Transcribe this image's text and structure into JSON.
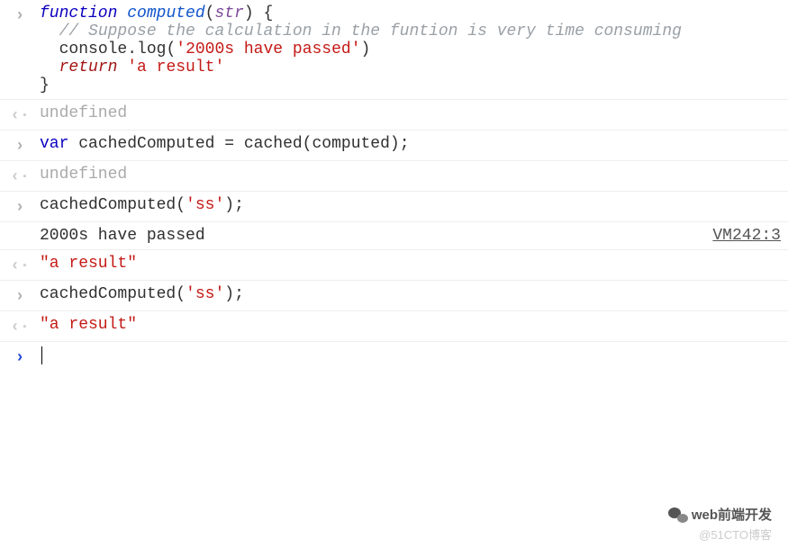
{
  "rows": {
    "r0": {
      "kw_function": "function",
      "fn": "computed",
      "param": "str",
      "brace_open": " {",
      "comment": "// Suppose the calculation in the funtion is very time consuming",
      "console": "console",
      "log": "log",
      "log_arg": "'2000s have passed'",
      "return": "return",
      "return_val": "'a result'",
      "brace_close": "}"
    },
    "r1": {
      "text": "undefined"
    },
    "r2": {
      "var": "var",
      "name": "cachedComputed",
      "eq": " = ",
      "call": "cached",
      "arg": "computed",
      "semi": ";"
    },
    "r3": {
      "text": "undefined"
    },
    "r4": {
      "call": "cachedComputed",
      "arg": "'ss'",
      "semi": ";"
    },
    "r5": {
      "text": "2000s have passed",
      "source": "VM242:3"
    },
    "r6": {
      "text": "\"a result\""
    },
    "r7": {
      "call": "cachedComputed",
      "arg": "'ss'",
      "semi": ";"
    },
    "r8": {
      "text": "\"a result\""
    }
  },
  "watermark": {
    "line1": "web前端开发",
    "line2": "@51CTO博客"
  }
}
